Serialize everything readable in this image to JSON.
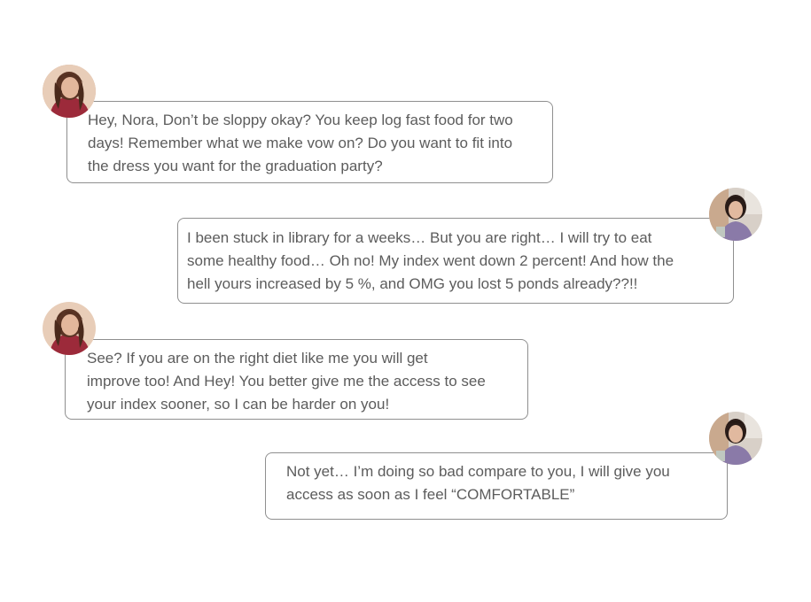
{
  "conversation": {
    "messages": [
      {
        "sender": "friend",
        "text": "Hey, Nora, Don’t be sloppy okay? You keep log fast food for two\ndays! Remember what we make vow on? Do you want to fit into\nthe dress you want for the graduation party?"
      },
      {
        "sender": "nora",
        "text": "I been stuck in library for a weeks… But you are right… I will try to eat\nsome healthy food… Oh no! My index went down 2 percent! And how the\nhell yours increased by 5 %, and OMG you lost 5 ponds already??!!"
      },
      {
        "sender": "friend",
        "text": "See? If you are on the right diet like me you will get\nimprove too! And Hey! You better give me the access to see\nyour index sooner, so I can be harder on you!"
      },
      {
        "sender": "nora",
        "text": "Not yet… I’m doing so bad compare to you, I will give you\naccess as soon as I feel “COMFORTABLE”"
      }
    ]
  },
  "colors": {
    "bubble_border": "#8f8f8f",
    "text": "#5c5c5c",
    "background": "#ffffff"
  },
  "icons": {
    "friend_avatar": "friend-avatar-photo",
    "nora_avatar": "nora-avatar-photo"
  }
}
